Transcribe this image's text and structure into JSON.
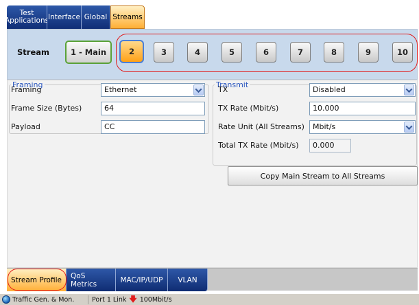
{
  "top_tabs": [
    {
      "label": "Test\nApplications"
    },
    {
      "label": "Interface"
    },
    {
      "label": "Global"
    },
    {
      "label": "Streams"
    }
  ],
  "stream_bar": {
    "label": "Stream",
    "buttons": [
      "1 - Main",
      "2",
      "3",
      "4",
      "5",
      "6",
      "7",
      "8",
      "9",
      "10"
    ],
    "selected": "2"
  },
  "framing": {
    "title": "Framing",
    "framing_label": "Framing",
    "framing_value": "Ethernet",
    "frame_size_label": "Frame Size (Bytes)",
    "frame_size_value": "64",
    "payload_label": "Payload",
    "payload_value": "CC"
  },
  "transmit": {
    "title": "Transmit",
    "tx_label": "TX",
    "tx_value": "Disabled",
    "tx_rate_label": "TX Rate (Mbit/s)",
    "tx_rate_value": "10.000",
    "rate_unit_label": "Rate Unit (All Streams)",
    "rate_unit_value": "Mbit/s",
    "total_rate_label": "Total TX Rate (Mbit/s)",
    "total_rate_value": "0.000"
  },
  "copy_button": "Copy Main Stream to All Streams",
  "bottom_tabs": [
    {
      "label": "Stream Profile"
    },
    {
      "label": "QoS Metrics"
    },
    {
      "label": "MAC/IP/UDP"
    },
    {
      "label": "VLAN"
    }
  ],
  "status_bar": {
    "app": "Traffic Gen. & Mon.",
    "port": "Port 1 Link",
    "speed": "100Mbit/s",
    "link_icon": "red-down-arrow-icon"
  },
  "colors": {
    "tab_blue": "#1a3f8c",
    "tab_active": "#ffae35",
    "highlight_ring": "#e11c1c",
    "main_border": "#59a137",
    "group_title": "#2a57bf"
  }
}
